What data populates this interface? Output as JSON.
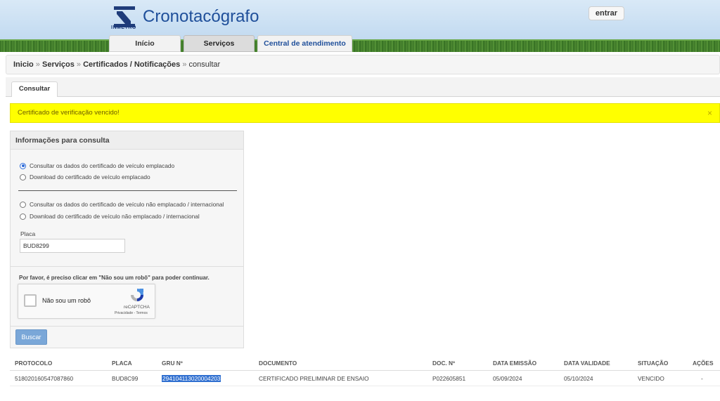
{
  "header": {
    "logo_text": "INMETRO",
    "title": "Cronotacógrafo",
    "login_label": "entrar",
    "nav": [
      {
        "label": "Início"
      },
      {
        "label": "Serviços"
      },
      {
        "label": "Central de atendimento"
      }
    ]
  },
  "breadcrumb": {
    "items": [
      "Inicio",
      "Serviços",
      "Certificados / Notificações"
    ],
    "current": "consultar",
    "separator": "»"
  },
  "tab": {
    "label": "Consultar"
  },
  "alert": {
    "message": "Certificado de verificação vencido!",
    "close": "×",
    "color": "#ffff00"
  },
  "form": {
    "title": "Informações para consulta",
    "options": [
      {
        "label": "Consultar os dados do certificado de veículo emplacado",
        "selected": true
      },
      {
        "label": "Download do certificado de veículo emplacado",
        "selected": false
      },
      {
        "label": "Consultar os dados do certificado de veículo não emplacado / internacional",
        "selected": false
      },
      {
        "label": "Download do certificado de veículo não emplacado / internacional",
        "selected": false
      }
    ],
    "placa_label": "Placa",
    "placa_value": "BUD8299",
    "robot_note": "Por favor, é preciso clicar em \"Não sou um robô\" para poder continuar.",
    "recaptcha": {
      "label": "Não sou um robô",
      "brand": "reCAPTCHA",
      "links": "Privacidade - Termos"
    },
    "submit_label": "Buscar"
  },
  "results": {
    "columns": [
      "PROTOCOLO",
      "PLACA",
      "GRU Nº",
      "DOCUMENTO",
      "DOC. Nº",
      "DATA EMISSÃO",
      "DATA VALIDADE",
      "SITUAÇÃO",
      "AÇÕES"
    ],
    "rows": [
      [
        "518020160547087860",
        "BUD8C99",
        "294104113020004203",
        "CERTIFICADO PRELIMINAR DE ENSAIO",
        "P022605851",
        "05/09/2024",
        "05/10/2024",
        "VENCIDO",
        "-"
      ]
    ]
  }
}
